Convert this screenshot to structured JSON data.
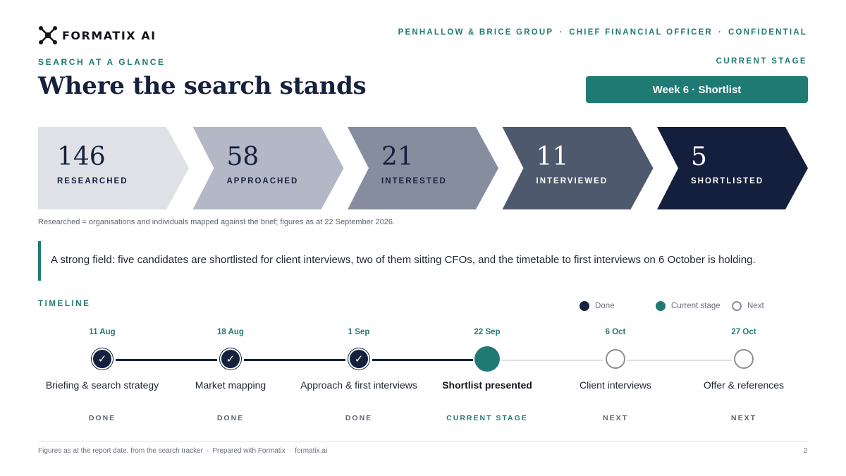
{
  "brand": {
    "logo_text": "FORMATIX AI"
  },
  "header": {
    "client": "PENHALLOW & BRICE GROUP",
    "role": "CHIEF FINANCIAL OFFICER",
    "classification": "CONFIDENTIAL",
    "separator": "·"
  },
  "section": {
    "eyebrow": "SEARCH AT A GLANCE",
    "title": "Where the search stands",
    "stage_label": "CURRENT STAGE",
    "stage_value": "Week 6 · Shortlist"
  },
  "funnel": [
    {
      "value": "146",
      "label": "RESEARCHED",
      "fill": "#dfe1e6",
      "text_color": "#16213e"
    },
    {
      "value": "58",
      "label": "APPROACHED",
      "fill": "#b4b8c6",
      "text_color": "#16213e"
    },
    {
      "value": "21",
      "label": "INTERESTED",
      "fill": "#868d9f",
      "text_color": "#16213e"
    },
    {
      "value": "11",
      "label": "INTERVIEWED",
      "fill": "#4e596d",
      "text_color": "#ffffff"
    },
    {
      "value": "5",
      "label": "SHORTLISTED",
      "fill": "#141f3e",
      "text_color": "#ffffff"
    }
  ],
  "footnote": "Researched = organisations and individuals mapped against the brief; figures as at 22 September 2026.",
  "callout": "A strong field: five candidates are shortlisted for client interviews, two of them sitting CFOs, and the timetable to first interviews on 6 October is holding.",
  "timeline": {
    "heading": "TIMELINE",
    "legend": {
      "done": "Done",
      "current": "Current stage",
      "next": "Next"
    },
    "check_glyph": "✓",
    "stages": [
      {
        "date": "11 Aug",
        "name": "Briefing & search strategy",
        "status": "DONE",
        "state": "done"
      },
      {
        "date": "18 Aug",
        "name": "Market mapping",
        "status": "DONE",
        "state": "done"
      },
      {
        "date": "1 Sep",
        "name": "Approach & first interviews",
        "status": "DONE",
        "state": "done"
      },
      {
        "date": "22 Sep",
        "name": "Shortlist presented",
        "status": "CURRENT STAGE",
        "state": "current"
      },
      {
        "date": "6 Oct",
        "name": "Client interviews",
        "status": "NEXT",
        "state": "next"
      },
      {
        "date": "27 Oct",
        "name": "Offer & references",
        "status": "NEXT",
        "state": "next"
      }
    ]
  },
  "footer": {
    "source": "Figures as at the report date, from the search tracker",
    "prepared": "Prepared with Formatix",
    "site": "formatix.ai",
    "separator": "·",
    "page": "2"
  },
  "colors": {
    "accent": "#1f7a74",
    "navy": "#16213e"
  }
}
